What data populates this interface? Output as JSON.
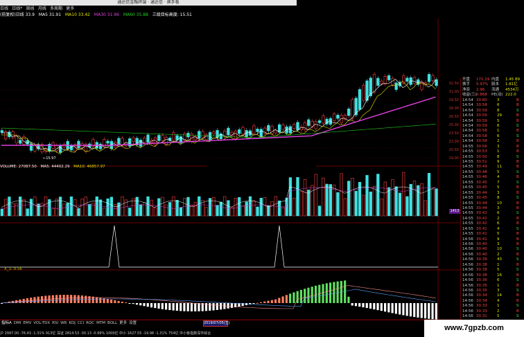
{
  "window": {
    "title": "通达信金融终端 · 通达信 · 换手板"
  },
  "menu": {
    "items": [
      "日线",
      "日线*",
      "周线",
      "月线",
      "多周期",
      "更多"
    ]
  },
  "ma_legend": [
    {
      "label": "(前复权)日线 33.9",
      "color": "#ffffff"
    },
    {
      "label": "MA5 31.91",
      "color": "#ffffff"
    },
    {
      "label": "MA10 33.42",
      "color": "#e6e600"
    },
    {
      "label": "MA30 31.96",
      "color": "#e040e0"
    },
    {
      "label": "MA60 35.88",
      "color": "#20d020"
    },
    {
      "label": "三级目标高度: 15.51",
      "color": "#ffffff"
    }
  ],
  "price_axis": [
    "32.50",
    "31.00",
    "29.50",
    "28.00",
    "26.50",
    "25.00",
    "23.50",
    "22.00",
    "20.50",
    "19.00"
  ],
  "annotations": {
    "low_price": "←15.97",
    "tooltip_date": "19.90"
  },
  "quote": {
    "summary": [
      {
        "k": "开盘",
        "v": "171.19",
        "k2": "内盘",
        "v2": "1.45 89"
      },
      {
        "k": "换手",
        "v": "5.97%",
        "k2": "股本",
        "v2": "1.81亿"
      },
      {
        "k": "净资",
        "v": "2.96",
        "k2": "流通",
        "v2": "4534万"
      },
      {
        "k": "收益(三)",
        "v": "0.868",
        "k2": "PE(动)",
        "v2": "222.0"
      }
    ],
    "ticks": [
      [
        "14:54",
        "30.60",
        "3",
        "B"
      ],
      [
        "14:54",
        "30.58",
        "6",
        "B"
      ],
      [
        "14:54",
        "30.59",
        "8",
        "S"
      ],
      [
        "14:54",
        "30.59",
        "29",
        "B"
      ],
      [
        "14:54",
        "30.59",
        "5",
        "B"
      ],
      [
        "14:54",
        "30.59",
        "6",
        "S"
      ],
      [
        "14:54",
        "30.58",
        "1",
        "B"
      ],
      [
        "14:54",
        "30.58",
        "6",
        "S"
      ],
      [
        "14:54",
        "30.58",
        "2",
        "B"
      ],
      [
        "14:55",
        "30.56",
        "3",
        "B"
      ],
      [
        "14:55",
        "30.53",
        "1",
        "B"
      ],
      [
        "14:55",
        "30.50",
        "8",
        "S"
      ],
      [
        "14:55",
        "30.51",
        "9",
        "B"
      ],
      [
        "14:55",
        "30.49",
        "11",
        "B"
      ],
      [
        "14:55",
        "30.48",
        "5",
        "S"
      ],
      [
        "14:55",
        "30.46",
        "4",
        "B"
      ],
      [
        "14:55",
        "30.45",
        "7",
        "S"
      ],
      [
        "14:55",
        "30.45",
        "5",
        "B"
      ],
      [
        "14:55",
        "30.44",
        "3",
        "B"
      ],
      [
        "14:55",
        "30.45",
        "8",
        "S"
      ],
      [
        "14:55",
        "30.44",
        "10",
        "B"
      ],
      [
        "14:55",
        "30.44",
        "3",
        "B"
      ],
      [
        "14:55",
        "30.42",
        "6",
        "S"
      ],
      [
        "14:55",
        "30.41",
        "2",
        "B"
      ],
      [
        "14:55",
        "30.42",
        "6",
        "B"
      ],
      [
        "14:55",
        "30.41",
        "4",
        "S"
      ],
      [
        "14:55",
        "30.41",
        "5",
        "B"
      ],
      [
        "14:56",
        "30.41",
        "9",
        "B"
      ],
      [
        "14:56",
        "30.40",
        "3",
        "B"
      ],
      [
        "14:56",
        "30.40",
        "10",
        "S"
      ],
      [
        "14:56",
        "30.40",
        "2",
        "B"
      ],
      [
        "14:56",
        "30.39",
        "43",
        "S"
      ],
      [
        "14:56",
        "30.38",
        "1",
        "B"
      ],
      [
        "14:56",
        "30.38",
        "5",
        "S"
      ],
      [
        "14:56",
        "30.38",
        "16",
        "B"
      ],
      [
        "14:56",
        "30.36",
        "6",
        "S"
      ],
      [
        "14:56",
        "30.35",
        "1",
        "B"
      ],
      [
        "14:56",
        "30.35",
        "3",
        "S"
      ],
      [
        "14:56",
        "30.34",
        "14",
        "B"
      ],
      [
        "14:56",
        "30.34",
        "4",
        "B"
      ],
      [
        "14:56",
        "30.33",
        "1",
        "S"
      ],
      [
        "14:56",
        "30.33",
        "2",
        "B"
      ],
      [
        "14:56",
        "30.31",
        "5",
        "S"
      ]
    ]
  },
  "volume_legend": [
    {
      "label": "VOLUME: 27087.50",
      "color": "#ffffff"
    },
    {
      "label": "MA5: 44402.29",
      "color": "#ffffff"
    },
    {
      "label": "MA10: 46857.97",
      "color": "#e6e600"
    }
  ],
  "volume_label": "1413",
  "indicator_legend": "X_1: 0.56",
  "bottom_tabs": [
    "指标A",
    "DMI",
    "EMV",
    "VOL-TDX",
    "RSI",
    "WR",
    "KDJ",
    "CCI",
    "ROC",
    "MTM",
    "BOLL",
    "更多",
    "设置"
  ],
  "date_label": "2019/07/05(五)",
  "status_text": "沪 2997.00 -76.43 -1.31% 913亿  深证 2814.53 -30.13 -0.99% 1000亿  中小 1627.55 -19.98 -1.31% 754亿  中小板指数深市综合",
  "watermark": "www.7gpzb.com",
  "colors": {
    "up": "#ff4040",
    "down": "#40e0e0",
    "bg": "#000000",
    "grid": "#6a0000"
  }
}
